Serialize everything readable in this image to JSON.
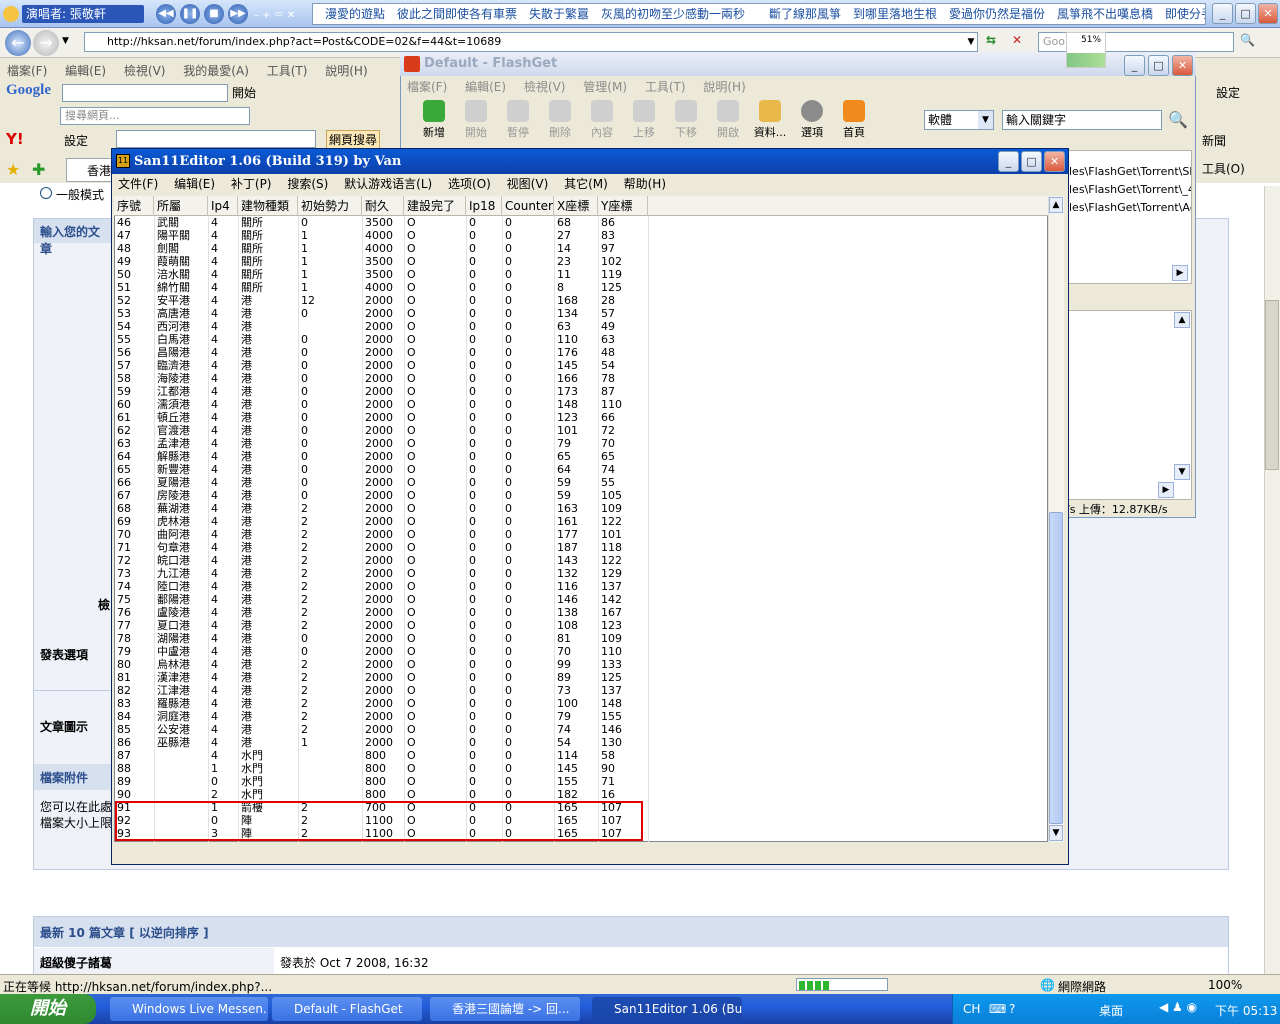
{
  "media_bar": {
    "song_label": "演唱者: 張敬軒",
    "marquee": "漫愛的遊點　彼此之間即使各有車票　失散于繁囂　灰風的初吻至少感動一兩秒　　斷了線那風箏　到哪里落地生根　愛過你仍然是福份　風箏飛不出嘆息橋　即使分手"
  },
  "ie": {
    "address": "http://hksan.net/forum/index.php?act=Post&CODE=02&f=44&t=10689",
    "search_placeholder": "Goo",
    "menu": [
      "檔案(F)",
      "編輯(E)",
      "檢視(V)",
      "我的最愛(A)",
      "工具(T)",
      "說明(H)"
    ],
    "google_label": "Google",
    "google_start": "開始",
    "search_web_placeholder": "搜尋網頁...",
    "web_search": "網頁搜尋",
    "settings": "設定",
    "settings2": "設定",
    "news": "新聞",
    "tools": "工具(O)",
    "tab_label": "香港"
  },
  "forum": {
    "radio_label": "一般模式",
    "enter_text": "輸入您的文章",
    "post_options": "發表選項",
    "post_icon": "文章圖示",
    "attachments": "檔案附件",
    "attach_line1": "您可以在此處",
    "attach_line2": "檔案大小上限",
    "recent_header": "最新 10 篇文章 [ 以逆向排序 ]",
    "recent_author": "超級傻子諸葛",
    "recent_date": "發表於 Oct 7 2008, 16:32",
    "stray_char": "檢"
  },
  "statusbar": {
    "text": "正在等候 http://hksan.net/forum/index.php?...",
    "zone": "網際網路",
    "zoom": "100%"
  },
  "taskbar": {
    "start": "開始",
    "tasks": [
      "Windows Live Messen...",
      "Default - FlashGet",
      "香港三國論壇 -> 回...",
      "San11Editor 1.06 (Bui..."
    ],
    "lang": "CH",
    "desktop": "桌面",
    "time": "下午 05:13"
  },
  "flashget": {
    "title": "Default - FlashGet",
    "menu": [
      "檔案(F)",
      "編輯(E)",
      "檢視(V)",
      "管理(M)",
      "工具(T)",
      "說明(H)"
    ],
    "tools": [
      "新增",
      "開始",
      "暫停",
      "刪除",
      "內容",
      "上移",
      "下移",
      "開啟",
      "資料...",
      "選項",
      "首頁"
    ],
    "category": "軟體",
    "keyword": "輸入關鍵字",
    "paths": [
      "les\\FlashGet\\Torrent\\Shin.",
      "les\\FlashGet\\Torrent\\_4.to",
      "les\\FlashGet\\Torrent\\Age O"
    ],
    "status": "/s 上傳：12.87KB/s",
    "mini_graph": "51%"
  },
  "editor": {
    "title": "San11Editor 1.06 (Build 319) by Van",
    "menu": [
      "文件(F)",
      "编辑(E)",
      "补丁(P)",
      "搜索(S)",
      "默认游戏语言(L)",
      "选项(O)",
      "视图(V)",
      "其它(M)",
      "帮助(H)"
    ],
    "columns": [
      "序號",
      "所屬",
      "Ip4",
      "建物種類",
      "初始勢力",
      "耐久",
      "建設完了",
      "Ip18",
      "Counter",
      "X座標",
      "Y座標"
    ],
    "rows": [
      [
        "46",
        "武關",
        "4",
        "關所",
        "0",
        "3500",
        "O",
        "0",
        "0",
        "68",
        "86"
      ],
      [
        "47",
        "陽平關",
        "4",
        "關所",
        "1",
        "4000",
        "O",
        "0",
        "0",
        "27",
        "83"
      ],
      [
        "48",
        "劍閣",
        "4",
        "關所",
        "1",
        "4000",
        "O",
        "0",
        "0",
        "14",
        "97"
      ],
      [
        "49",
        "葭萌關",
        "4",
        "關所",
        "1",
        "3500",
        "O",
        "0",
        "0",
        "23",
        "102"
      ],
      [
        "50",
        "涪水關",
        "4",
        "關所",
        "1",
        "3500",
        "O",
        "0",
        "0",
        "11",
        "119"
      ],
      [
        "51",
        "綿竹關",
        "4",
        "關所",
        "1",
        "4000",
        "O",
        "0",
        "0",
        "8",
        "125"
      ],
      [
        "52",
        "安平港",
        "4",
        "港",
        "12",
        "2000",
        "O",
        "0",
        "0",
        "168",
        "28"
      ],
      [
        "53",
        "高唐港",
        "4",
        "港",
        "0",
        "2000",
        "O",
        "0",
        "0",
        "134",
        "57"
      ],
      [
        "54",
        "西河港",
        "4",
        "港",
        "",
        "2000",
        "O",
        "0",
        "0",
        "63",
        "49"
      ],
      [
        "55",
        "白馬港",
        "4",
        "港",
        "0",
        "2000",
        "O",
        "0",
        "0",
        "110",
        "63"
      ],
      [
        "56",
        "昌陽港",
        "4",
        "港",
        "0",
        "2000",
        "O",
        "0",
        "0",
        "176",
        "48"
      ],
      [
        "57",
        "臨濟港",
        "4",
        "港",
        "0",
        "2000",
        "O",
        "0",
        "0",
        "145",
        "54"
      ],
      [
        "58",
        "海陵港",
        "4",
        "港",
        "0",
        "2000",
        "O",
        "0",
        "0",
        "166",
        "78"
      ],
      [
        "59",
        "江都港",
        "4",
        "港",
        "0",
        "2000",
        "O",
        "0",
        "0",
        "173",
        "87"
      ],
      [
        "60",
        "濡須港",
        "4",
        "港",
        "0",
        "2000",
        "O",
        "0",
        "0",
        "148",
        "110"
      ],
      [
        "61",
        "頓丘港",
        "4",
        "港",
        "0",
        "2000",
        "O",
        "0",
        "0",
        "123",
        "66"
      ],
      [
        "62",
        "官渡港",
        "4",
        "港",
        "0",
        "2000",
        "O",
        "0",
        "0",
        "101",
        "72"
      ],
      [
        "63",
        "孟津港",
        "4",
        "港",
        "0",
        "2000",
        "O",
        "0",
        "0",
        "79",
        "70"
      ],
      [
        "64",
        "解縣港",
        "4",
        "港",
        "0",
        "2000",
        "O",
        "0",
        "0",
        "65",
        "65"
      ],
      [
        "65",
        "新豐港",
        "4",
        "港",
        "0",
        "2000",
        "O",
        "0",
        "0",
        "64",
        "74"
      ],
      [
        "66",
        "夏陽港",
        "4",
        "港",
        "0",
        "2000",
        "O",
        "0",
        "0",
        "59",
        "55"
      ],
      [
        "67",
        "房陵港",
        "4",
        "港",
        "0",
        "2000",
        "O",
        "0",
        "0",
        "59",
        "105"
      ],
      [
        "68",
        "蕪湖港",
        "4",
        "港",
        "2",
        "2000",
        "O",
        "0",
        "0",
        "163",
        "109"
      ],
      [
        "69",
        "虎林港",
        "4",
        "港",
        "2",
        "2000",
        "O",
        "0",
        "0",
        "161",
        "122"
      ],
      [
        "70",
        "曲阿港",
        "4",
        "港",
        "2",
        "2000",
        "O",
        "0",
        "0",
        "177",
        "101"
      ],
      [
        "71",
        "句章港",
        "4",
        "港",
        "2",
        "2000",
        "O",
        "0",
        "0",
        "187",
        "118"
      ],
      [
        "72",
        "皖口港",
        "4",
        "港",
        "2",
        "2000",
        "O",
        "0",
        "0",
        "143",
        "122"
      ],
      [
        "73",
        "九江港",
        "4",
        "港",
        "2",
        "2000",
        "O",
        "0",
        "0",
        "132",
        "129"
      ],
      [
        "74",
        "陸口港",
        "4",
        "港",
        "2",
        "2000",
        "O",
        "0",
        "0",
        "116",
        "137"
      ],
      [
        "75",
        "鄱陽港",
        "4",
        "港",
        "2",
        "2000",
        "O",
        "0",
        "0",
        "146",
        "142"
      ],
      [
        "76",
        "盧陵港",
        "4",
        "港",
        "2",
        "2000",
        "O",
        "0",
        "0",
        "138",
        "167"
      ],
      [
        "77",
        "夏口港",
        "4",
        "港",
        "2",
        "2000",
        "O",
        "0",
        "0",
        "108",
        "123"
      ],
      [
        "78",
        "湖陽港",
        "4",
        "港",
        "0",
        "2000",
        "O",
        "0",
        "0",
        "81",
        "109"
      ],
      [
        "79",
        "中盧港",
        "4",
        "港",
        "0",
        "2000",
        "O",
        "0",
        "0",
        "70",
        "110"
      ],
      [
        "80",
        "烏林港",
        "4",
        "港",
        "2",
        "2000",
        "O",
        "0",
        "0",
        "99",
        "133"
      ],
      [
        "81",
        "漢津港",
        "4",
        "港",
        "2",
        "2000",
        "O",
        "0",
        "0",
        "89",
        "125"
      ],
      [
        "82",
        "江津港",
        "4",
        "港",
        "2",
        "2000",
        "O",
        "0",
        "0",
        "73",
        "137"
      ],
      [
        "83",
        "羅縣港",
        "4",
        "港",
        "2",
        "2000",
        "O",
        "0",
        "0",
        "100",
        "148"
      ],
      [
        "84",
        "洞庭港",
        "4",
        "港",
        "2",
        "2000",
        "O",
        "0",
        "0",
        "79",
        "155"
      ],
      [
        "85",
        "公安港",
        "4",
        "港",
        "2",
        "2000",
        "O",
        "0",
        "0",
        "74",
        "146"
      ],
      [
        "86",
        "巫縣港",
        "4",
        "港",
        "1",
        "2000",
        "O",
        "0",
        "0",
        "54",
        "130"
      ],
      [
        "87",
        "",
        "4",
        "水門",
        "",
        "800",
        "O",
        "0",
        "0",
        "114",
        "58"
      ],
      [
        "88",
        "",
        "1",
        "水門",
        "",
        "800",
        "O",
        "0",
        "0",
        "145",
        "90"
      ],
      [
        "89",
        "",
        "0",
        "水門",
        "",
        "800",
        "O",
        "0",
        "0",
        "155",
        "71"
      ],
      [
        "90",
        "",
        "2",
        "水門",
        "",
        "800",
        "O",
        "0",
        "0",
        "182",
        "16"
      ],
      [
        "91",
        "",
        "1",
        "箭樓",
        "2",
        "700",
        "O",
        "0",
        "0",
        "165",
        "107"
      ],
      [
        "92",
        "",
        "0",
        "陣",
        "2",
        "1100",
        "O",
        "0",
        "0",
        "165",
        "107"
      ],
      [
        "93",
        "",
        "3",
        "陣",
        "2",
        "1100",
        "O",
        "0",
        "0",
        "165",
        "107"
      ]
    ],
    "highlight_color": "#e00000"
  }
}
